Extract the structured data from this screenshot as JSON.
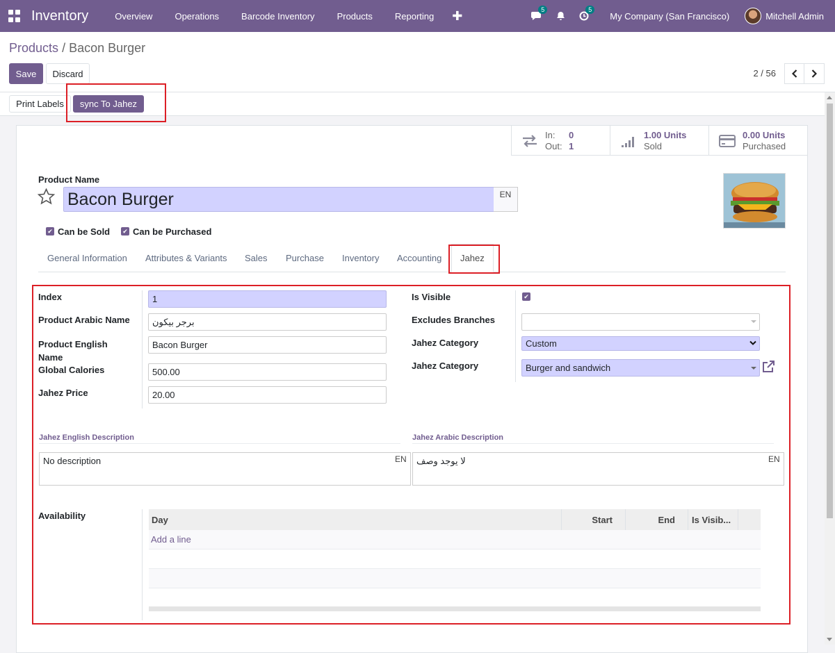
{
  "navbar": {
    "brand": "Inventory",
    "menu": [
      "Overview",
      "Operations",
      "Barcode Inventory",
      "Products",
      "Reporting"
    ],
    "plus": "✚",
    "messages_count": "5",
    "activity_count": "5",
    "company": "My Company (San Francisco)",
    "user": "Mitchell Admin"
  },
  "breadcrumb": {
    "parent": "Products",
    "separator": "/",
    "current": "Bacon Burger"
  },
  "buttons": {
    "save": "Save",
    "discard": "Discard",
    "print_labels": "Print Labels",
    "sync": "sync To Jahez"
  },
  "pager": {
    "value": "2 / 56",
    "prev": "‹",
    "next": "›"
  },
  "stats": {
    "in_label": "In:",
    "in_value": "0",
    "out_label": "Out:",
    "out_value": "1",
    "sold_value": "1.00 Units",
    "sold_label": "Sold",
    "purchased_value": "0.00 Units",
    "purchased_label": "Purchased"
  },
  "product": {
    "name_label": "Product Name",
    "name": "Bacon Burger",
    "lang": "EN",
    "can_be_sold": "Can be Sold",
    "can_be_purchased": "Can be Purchased"
  },
  "tabs": [
    "General Information",
    "Attributes & Variants",
    "Sales",
    "Purchase",
    "Inventory",
    "Accounting",
    "Jahez"
  ],
  "jahez": {
    "index_label": "Index",
    "index_value": "1",
    "arabic_name_label": "Product Arabic Name",
    "arabic_name_value": "برجر بيكون",
    "english_name_label_1": "Product English",
    "english_name_label_2": "Name",
    "english_name_value": "Bacon Burger",
    "calories_label": "Global Calories",
    "calories_value": "500.00",
    "price_label": "Jahez Price",
    "price_value": "20.00",
    "visible_label": "Is Visible",
    "excludes_label": "Excludes Branches",
    "excludes_value": "",
    "category_label_1": "Jahez Category",
    "category_value_1": "Custom",
    "category_label_2": "Jahez Category",
    "category_value_2": "Burger and sandwich",
    "en_desc_title": "Jahez English Description",
    "en_desc_value": "No description",
    "ar_desc_title": "Jahez Arabic Description",
    "ar_desc_value": "لا يوجد وصف",
    "desc_lang": "EN",
    "availability_label": "Availability",
    "columns": [
      "Day",
      "Start",
      "End",
      "Is Visib..."
    ],
    "add_line": "Add a line"
  },
  "colors": {
    "brand": "#715d8f",
    "highlight": "#dc1f26",
    "required_bg": "#d2d2ff",
    "badge": "#017e84"
  }
}
